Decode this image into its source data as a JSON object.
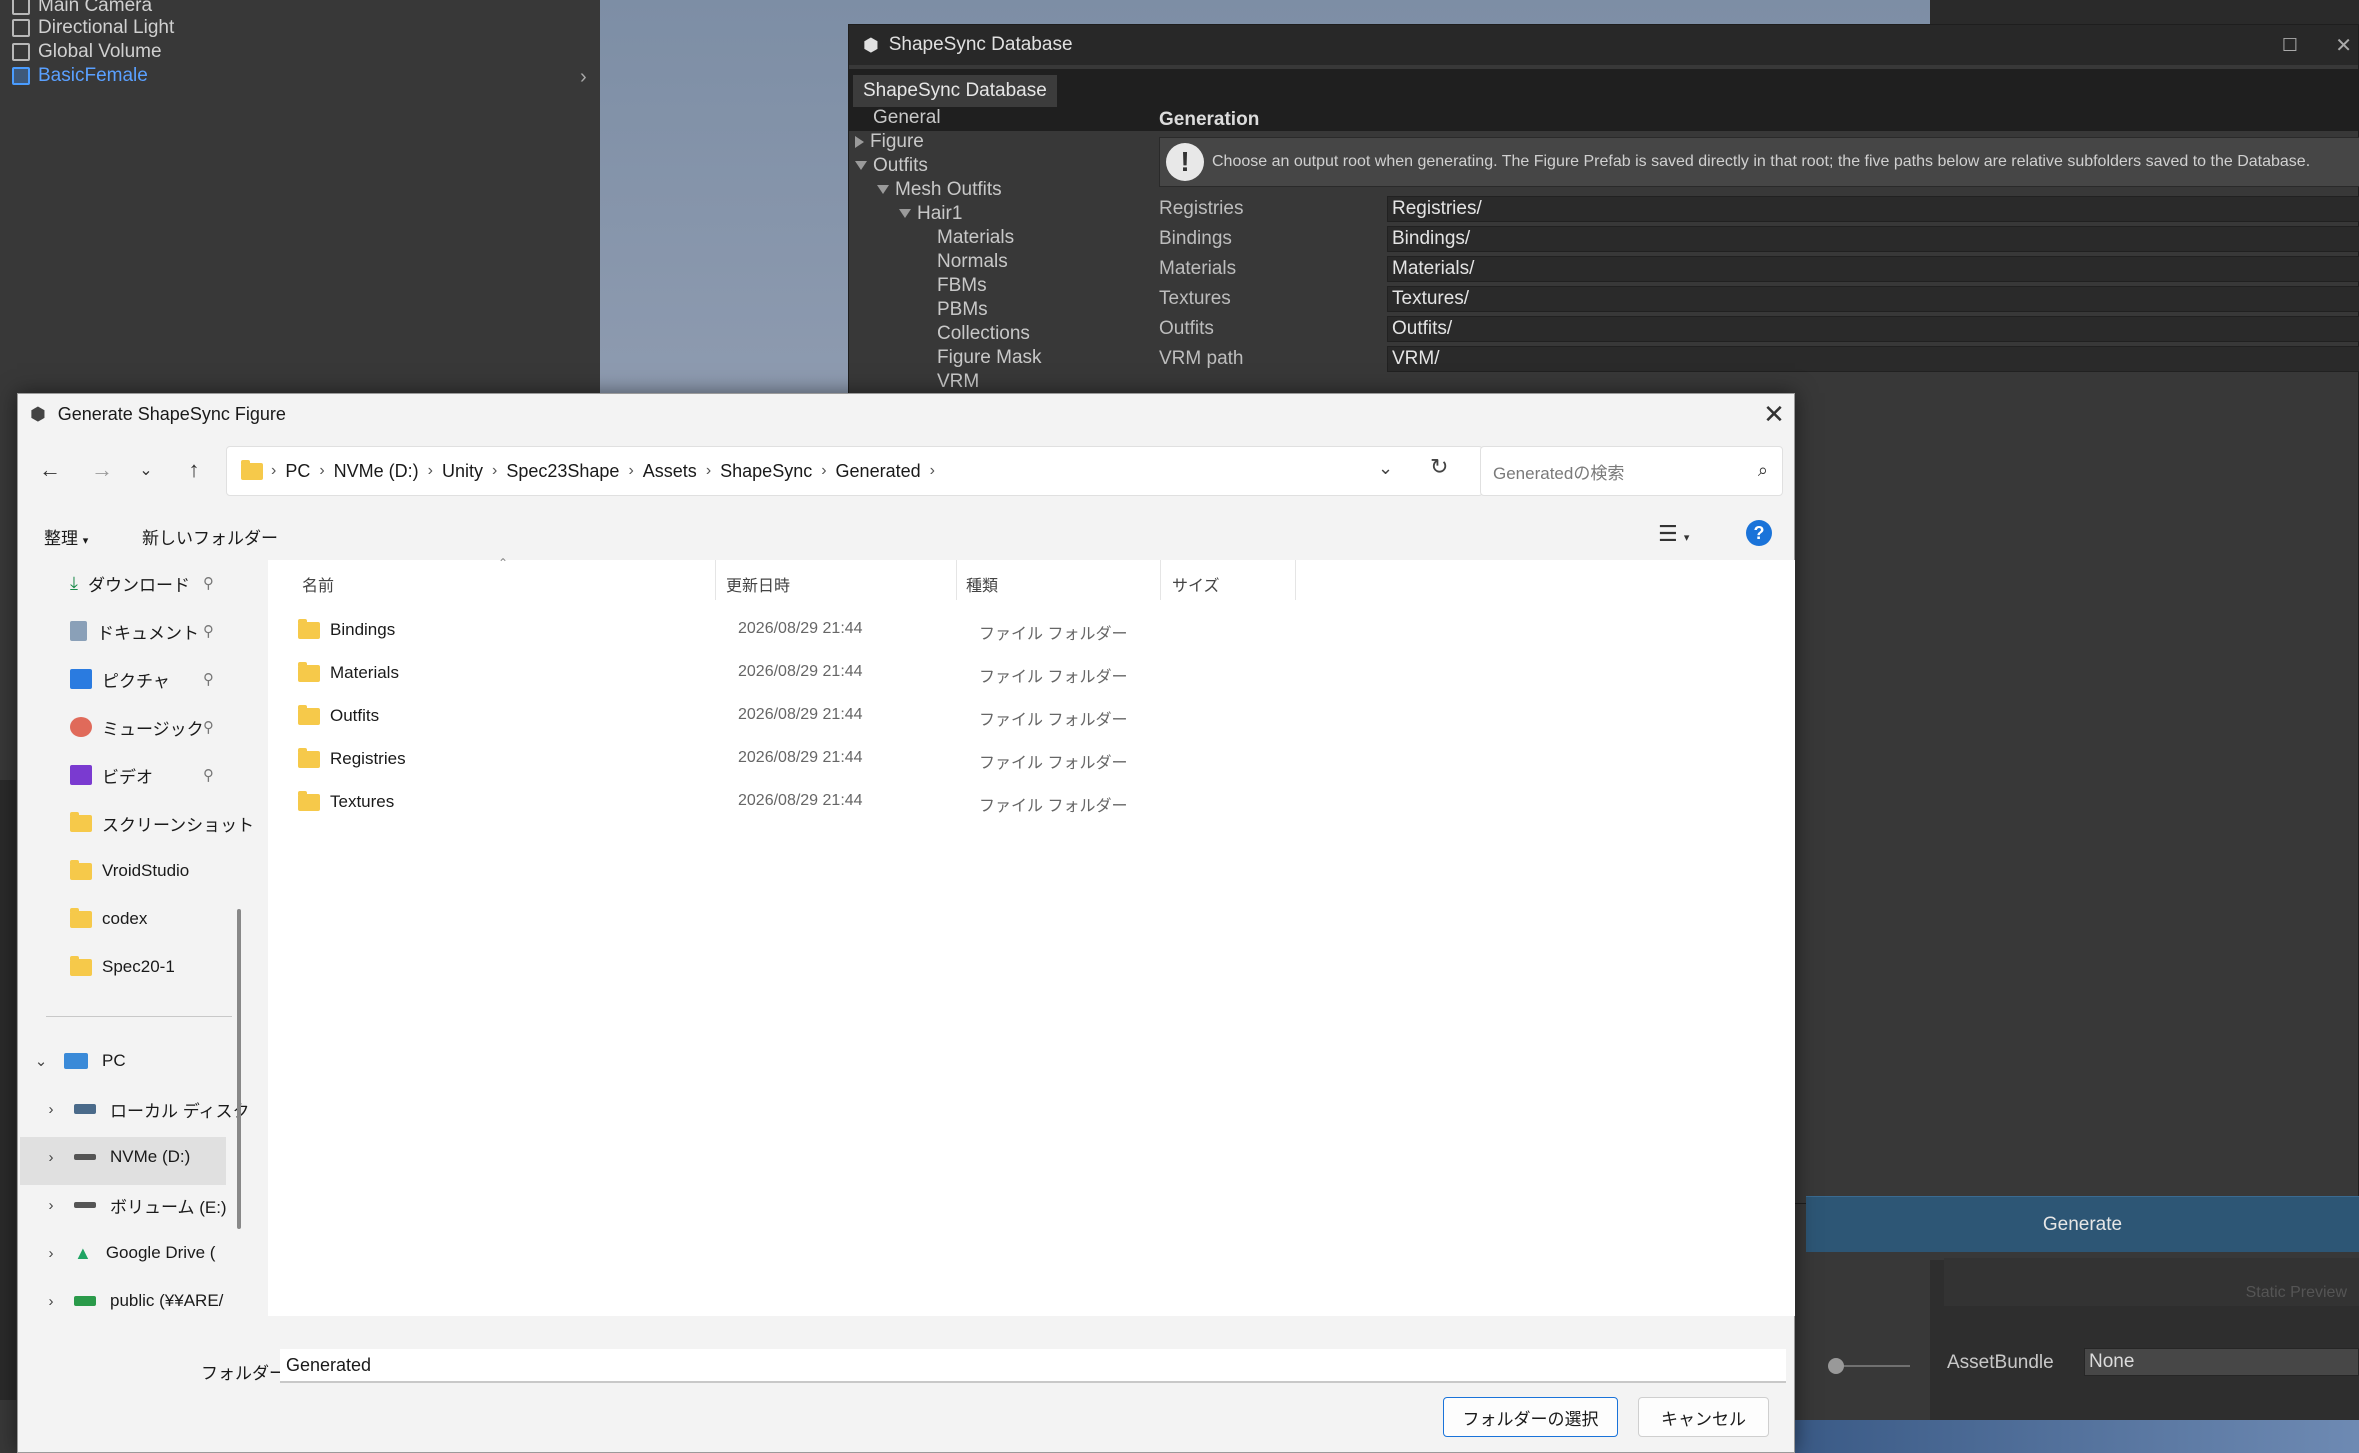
{
  "hierarchy": {
    "items": [
      {
        "label": "Main Camera"
      },
      {
        "label": "Directional Light"
      },
      {
        "label": "Global Volume"
      },
      {
        "label": "BasicFemale"
      }
    ]
  },
  "shapesync": {
    "window_title": "ShapeSync Database",
    "tab_label": "ShapeSync Database",
    "tree": {
      "general": "General",
      "figure": "Figure",
      "outfits": "Outfits",
      "mesh_outfits": "Mesh Outfits",
      "hair1": "Hair1",
      "materials": "Materials",
      "normals": "Normals",
      "fbms": "FBMs",
      "pbms": "PBMs",
      "collections": "Collections",
      "figure_mask": "Figure Mask",
      "vrm": "VRM"
    },
    "generation_heading": "Generation",
    "info_text": "Choose an output root when generating. The Figure Prefab is saved directly in that root; the five paths below are relative subfolders saved to the Database.",
    "fields": [
      {
        "label": "Registries",
        "value": "Registries/"
      },
      {
        "label": "Bindings",
        "value": "Bindings/"
      },
      {
        "label": "Materials",
        "value": "Materials/"
      },
      {
        "label": "Textures",
        "value": "Textures/"
      },
      {
        "label": "Outfits",
        "value": "Outfits/"
      },
      {
        "label": "VRM path",
        "value": "VRM/"
      }
    ],
    "generate_label": "Generate",
    "static_preview": "Static Preview",
    "assetbundle_label": "AssetBundle",
    "assetbundle_value": "None"
  },
  "dialog": {
    "title": "Generate ShapeSync Figure",
    "breadcrumb": [
      "PC",
      "NVMe (D:)",
      "Unity",
      "Spec23Shape",
      "Assets",
      "ShapeSync",
      "Generated"
    ],
    "search_placeholder": "Generatedの検索",
    "organize_label": "整理",
    "new_folder_label": "新しいフォルダー",
    "nav_quick": [
      {
        "label": "ダウンロード",
        "icon": "download-icon"
      },
      {
        "label": "ドキュメント",
        "icon": "document-icon"
      },
      {
        "label": "ピクチャ",
        "icon": "picture-icon"
      },
      {
        "label": "ミュージック",
        "icon": "music-icon"
      },
      {
        "label": "ビデオ",
        "icon": "video-icon"
      },
      {
        "label": "スクリーンショット",
        "icon": "folder-icon"
      },
      {
        "label": "VroidStudio",
        "icon": "folder-icon"
      },
      {
        "label": "codex",
        "icon": "folder-icon"
      },
      {
        "label": "Spec20-1",
        "icon": "folder-icon"
      }
    ],
    "nav_pc": {
      "pc": "PC",
      "drives": [
        {
          "label": "ローカル ディスク"
        },
        {
          "label": "NVMe (D:)"
        },
        {
          "label": "ボリューム (E:)"
        },
        {
          "label": "Google Drive ("
        },
        {
          "label": "public (¥¥ARE/"
        }
      ]
    },
    "columns": {
      "name": "名前",
      "date": "更新日時",
      "type": "種類",
      "size": "サイズ"
    },
    "files": [
      {
        "name": "Bindings",
        "date": "2026/08/29 21:44",
        "type": "ファイル フォルダー"
      },
      {
        "name": "Materials",
        "date": "2026/08/29 21:44",
        "type": "ファイル フォルダー"
      },
      {
        "name": "Outfits",
        "date": "2026/08/29 21:44",
        "type": "ファイル フォルダー"
      },
      {
        "name": "Registries",
        "date": "2026/08/29 21:44",
        "type": "ファイル フォルダー"
      },
      {
        "name": "Textures",
        "date": "2026/08/29 21:44",
        "type": "ファイル フォルダー"
      }
    ],
    "folder_label": "フォルダー:",
    "folder_value": "Generated",
    "select_label": "フォルダーの選択",
    "cancel_label": "キャンセル"
  }
}
